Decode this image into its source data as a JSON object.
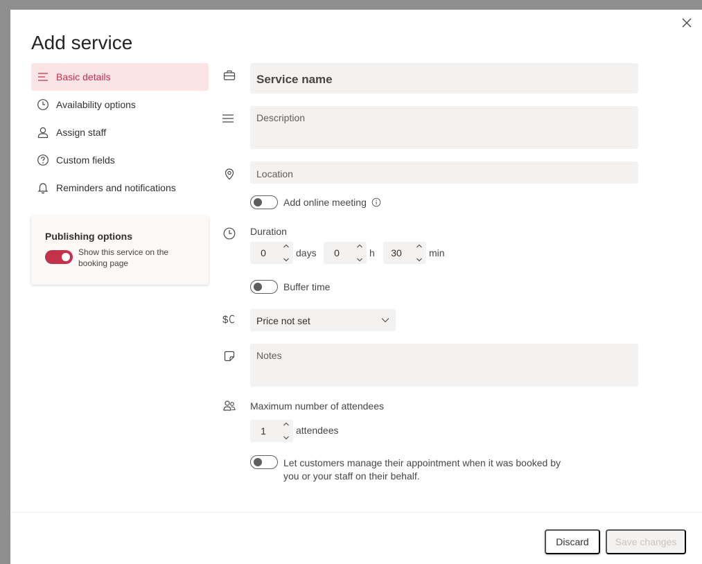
{
  "dialog": {
    "title": "Add service"
  },
  "nav": {
    "items": [
      {
        "label": "Basic details",
        "icon": "list-icon",
        "active": true
      },
      {
        "label": "Availability options",
        "icon": "clock-icon",
        "active": false
      },
      {
        "label": "Assign staff",
        "icon": "person-icon",
        "active": false
      },
      {
        "label": "Custom fields",
        "icon": "question-icon",
        "active": false
      },
      {
        "label": "Reminders and notifications",
        "icon": "bell-icon",
        "active": false
      }
    ]
  },
  "publishing": {
    "title": "Publishing options",
    "toggle_label": "Show this service on the booking page",
    "toggle_on": true
  },
  "form": {
    "service_name_placeholder": "Service name",
    "description_placeholder": "Description",
    "location_placeholder": "Location",
    "online_meeting_label": "Add online meeting",
    "duration_label": "Duration",
    "duration": {
      "days": "0",
      "days_unit": "days",
      "hours": "0",
      "hours_unit": "h",
      "minutes": "30",
      "minutes_unit": "min"
    },
    "buffer_time_label": "Buffer time",
    "price_value": "Price not set",
    "notes_placeholder": "Notes",
    "max_attendees_label": "Maximum number of attendees",
    "max_attendees_value": "1",
    "attendees_unit": "attendees",
    "manage_line1": "Let customers manage their appointment when it was booked by",
    "manage_line2": "you or your staff on their behalf."
  },
  "footer": {
    "discard_label": "Discard",
    "save_label": "Save changes"
  },
  "colors": {
    "accent": "#c4314b",
    "active_bg": "#fbe4e6",
    "field_bg": "#f3f2f1"
  }
}
